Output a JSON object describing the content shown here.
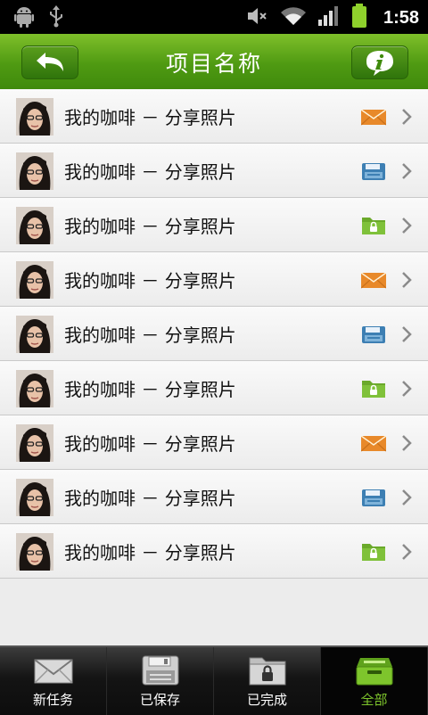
{
  "statusbar": {
    "time": "1:58",
    "icons": [
      "android-icon",
      "usb-icon",
      "mute-icon",
      "wifi-icon",
      "signal-icon",
      "battery-icon"
    ]
  },
  "header": {
    "title": "项目名称",
    "back_icon": "back-arrow-icon",
    "info_icon": "info-icon"
  },
  "list": {
    "items": [
      {
        "label": "我的咖啡 － 分享照片",
        "status": "mail"
      },
      {
        "label": "我的咖啡 － 分享照片",
        "status": "save"
      },
      {
        "label": "我的咖啡 － 分享照片",
        "status": "locked-folder"
      },
      {
        "label": "我的咖啡 － 分享照片",
        "status": "mail"
      },
      {
        "label": "我的咖啡 － 分享照片",
        "status": "save"
      },
      {
        "label": "我的咖啡 － 分享照片",
        "status": "locked-folder"
      },
      {
        "label": "我的咖啡 － 分享照片",
        "status": "mail"
      },
      {
        "label": "我的咖啡 － 分享照片",
        "status": "save"
      },
      {
        "label": "我的咖啡 － 分享照片",
        "status": "locked-folder"
      }
    ]
  },
  "tabs": [
    {
      "label": "新任务",
      "icon": "mail-icon",
      "active": false
    },
    {
      "label": "已保存",
      "icon": "floppy-icon",
      "active": false
    },
    {
      "label": "已完成",
      "icon": "locked-folder-icon",
      "active": false
    },
    {
      "label": "全部",
      "icon": "inbox-tray-icon",
      "active": true
    }
  ],
  "colors": {
    "accent_green": "#4f9a12",
    "mail_orange": "#e8892a",
    "save_blue": "#3d7fb3",
    "folder_green": "#6aa92a",
    "active_tab_text": "#7ec52c"
  }
}
